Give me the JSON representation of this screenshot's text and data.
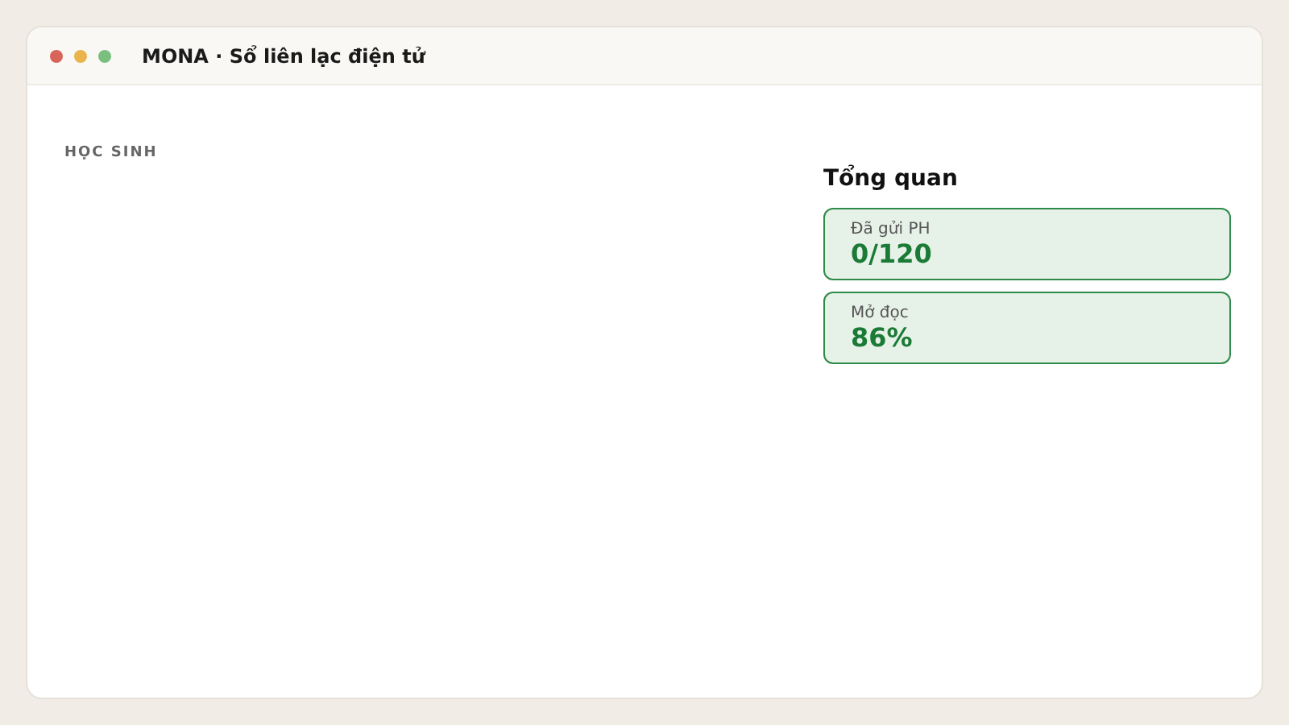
{
  "window": {
    "title": "MONA · Sổ liên lạc điện tử"
  },
  "students": {
    "heading": "HỌC SINH"
  },
  "overview": {
    "title": "Tổng quan",
    "stats": [
      {
        "label": "Đã gửi PH",
        "value": "0/120"
      },
      {
        "label": "Mở đọc",
        "value": "86%"
      }
    ]
  }
}
